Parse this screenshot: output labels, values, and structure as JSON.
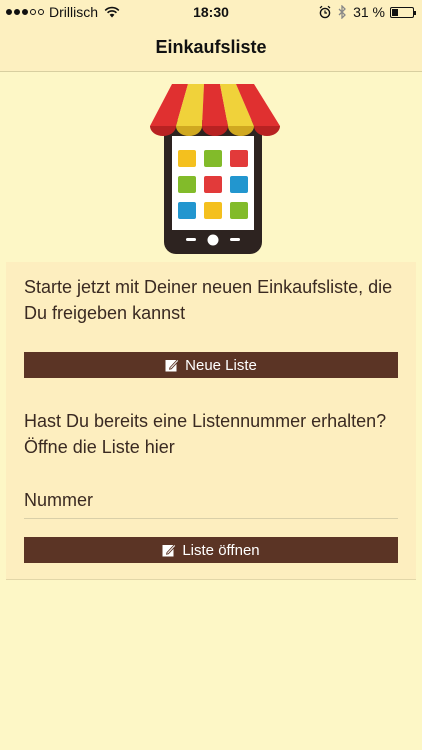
{
  "status_bar": {
    "carrier": "Drillisch",
    "time": "18:30",
    "battery": "31 %",
    "battery_level": 0.31,
    "icons": [
      "signal-dots",
      "wifi-icon",
      "alarm-icon",
      "bluetooth-icon",
      "battery-icon"
    ]
  },
  "nav": {
    "title": "Einkaufsliste"
  },
  "logo": {
    "icon": "shop-phone-logo",
    "colors": {
      "awning_red": "#e03030",
      "awning_yellow": "#f0d23a",
      "phone_body": "#2d2320",
      "tiles": [
        "#f4c01e",
        "#82bb2a",
        "#e23a3a",
        "#82bb2a",
        "#e23a3a",
        "#2296cf",
        "#2296cf",
        "#f4c01e",
        "#82bb2a"
      ]
    }
  },
  "main": {
    "intro": "Starte jetzt mit Deiner neuen Einkaufsliste, die Du freigeben kannst",
    "new_list_button": "Neue Liste",
    "prompt": "Hast Du bereits eine Listennummer erhalten? Öffne die Liste hier",
    "number_placeholder": "Nummer",
    "open_list_button": "Liste öffnen"
  },
  "colors": {
    "background": "#fdf7c6",
    "bar": "#fdf0c0",
    "card": "#fdeebf",
    "button": "#5b3425",
    "text": "#3a2a22"
  }
}
